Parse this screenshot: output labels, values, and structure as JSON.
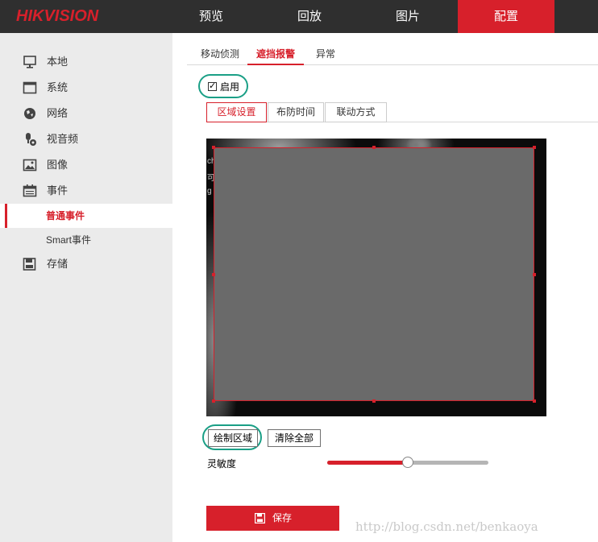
{
  "header": {
    "logo": "HIKVISION",
    "nav": [
      "预览",
      "回放",
      "图片",
      "配置"
    ],
    "active_nav": "配置"
  },
  "sidebar": {
    "items": [
      {
        "label": "本地",
        "icon": "monitor-icon"
      },
      {
        "label": "系统",
        "icon": "window-icon"
      },
      {
        "label": "网络",
        "icon": "globe-icon"
      },
      {
        "label": "视音频",
        "icon": "microphone-icon"
      },
      {
        "label": "图像",
        "icon": "image-icon"
      },
      {
        "label": "事件",
        "icon": "calendar-icon"
      },
      {
        "label": "存储",
        "icon": "disk-icon"
      }
    ],
    "sub_items": [
      "普通事件",
      "Smart事件"
    ],
    "active_sub": "普通事件"
  },
  "tabs": [
    "移动侦测",
    "遮挡报警",
    "异常"
  ],
  "active_tab": "遮挡报警",
  "enable": {
    "label": "启用",
    "checked": true
  },
  "subtabs": [
    "区域设置",
    "布防时间",
    "联动方式"
  ],
  "active_subtab": "区域设置",
  "buttons": {
    "draw": "绘制区域",
    "clear": "清除全部"
  },
  "sensitivity": {
    "label": "灵敏度",
    "value_fraction": 0.5
  },
  "save": {
    "label": "保存",
    "icon": "save-icon"
  },
  "watermark": "http://blog.csdn.net/benkaoya",
  "colors": {
    "accent": "#d7202b",
    "highlight": "#1a9f86",
    "header_bg": "#2f2f2f",
    "sidebar_bg": "#ebebeb"
  }
}
